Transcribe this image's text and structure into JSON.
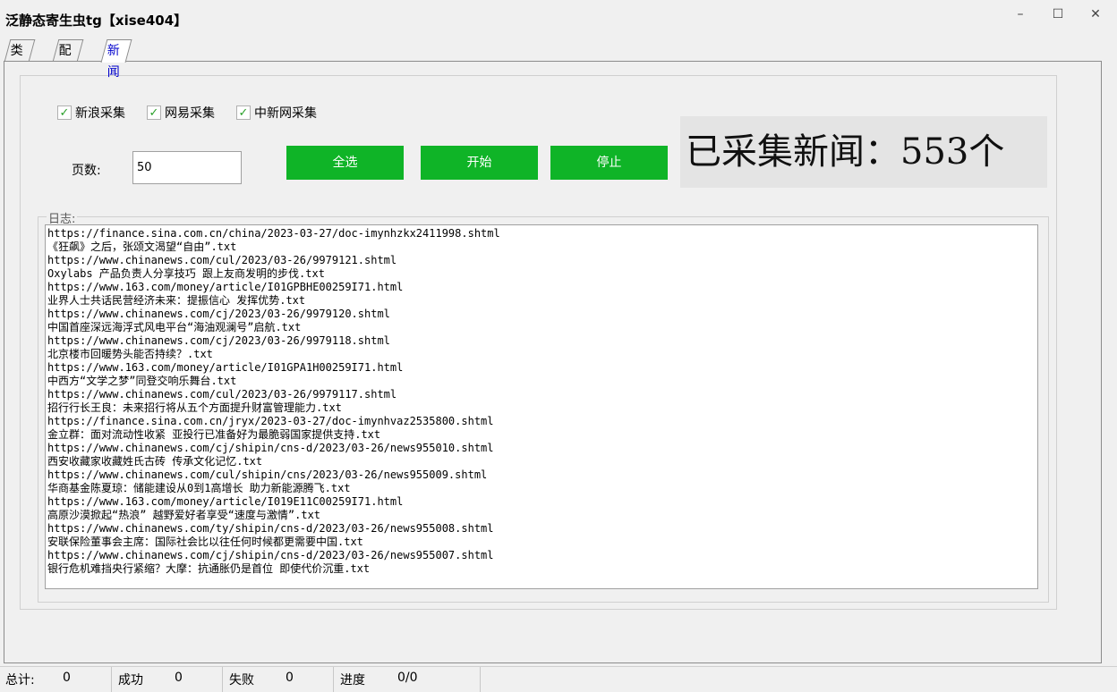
{
  "window": {
    "title": "泛静态寄生虫tg【xise404】",
    "minimize": "–",
    "maximize": "☐",
    "close": "✕"
  },
  "tabs": [
    {
      "label": "类型"
    },
    {
      "label": "配置"
    },
    {
      "label": "新闻"
    }
  ],
  "checkboxes": [
    {
      "label": "新浪采集",
      "checked": true
    },
    {
      "label": "网易采集",
      "checked": true
    },
    {
      "label": "中新网采集",
      "checked": true
    }
  ],
  "pages": {
    "label": "页数:",
    "value": "50"
  },
  "buttons": {
    "select_all": "全选",
    "start": "开始",
    "stop": "停止"
  },
  "counter": "已采集新闻：553个",
  "log": {
    "label": "日志:",
    "lines": [
      "https://finance.sina.com.cn/china/2023-03-27/doc-imynhzkx2411998.shtml",
      "《狂飙》之后，张颂文渴望“自由”.txt",
      "https://www.chinanews.com/cul/2023/03-26/9979121.shtml",
      "Oxylabs 产品负责人分享技巧 跟上友商发明的步伐.txt",
      "https://www.163.com/money/article/I01GPBHE00259I71.html",
      "业界人士共话民营经济未来：提振信心 发挥优势.txt",
      "https://www.chinanews.com/cj/2023/03-26/9979120.shtml",
      "中国首座深远海浮式风电平台“海油观澜号”启航.txt",
      "https://www.chinanews.com/cj/2023/03-26/9979118.shtml",
      "北京楼市回暖势头能否持续？.txt",
      "https://www.163.com/money/article/I01GPA1H00259I71.html",
      "中西方“文学之梦”同登交响乐舞台.txt",
      "https://www.chinanews.com/cul/2023/03-26/9979117.shtml",
      "招行行长王良：未来招行将从五个方面提升财富管理能力.txt",
      "https://finance.sina.com.cn/jryx/2023-03-27/doc-imynhvaz2535800.shtml",
      "金立群：面对流动性收紧 亚投行已准备好为最脆弱国家提供支持.txt",
      "https://www.chinanews.com/cj/shipin/cns-d/2023/03-26/news955010.shtml",
      "西安收藏家收藏姓氏古砖 传承文化记忆.txt",
      "https://www.chinanews.com/cul/shipin/cns/2023/03-26/news955009.shtml",
      "华商基金陈夏琼：储能建设从0到1高增长 助力新能源腾飞.txt",
      "https://www.163.com/money/article/I019E11C00259I71.html",
      "高原沙漠掀起“热浪” 越野爱好者享受“速度与激情”.txt",
      "https://www.chinanews.com/ty/shipin/cns-d/2023/03-26/news955008.shtml",
      "安联保险董事会主席：国际社会比以往任何时候都更需要中国.txt",
      "https://www.chinanews.com/cj/shipin/cns-d/2023/03-26/news955007.shtml",
      "银行危机难挡央行紧缩？大摩：抗通胀仍是首位 即使代价沉重.txt"
    ]
  },
  "status": {
    "total_label": "总计:",
    "total_value": "0",
    "success_label": "成功",
    "success_value": "0",
    "fail_label": "失败",
    "fail_value": "0",
    "progress_label": "进度",
    "progress_value": "0/0"
  },
  "colors": {
    "button_green": "#0fb427",
    "active_tab_text": "#0000cc",
    "check_green": "#2aa02a"
  }
}
